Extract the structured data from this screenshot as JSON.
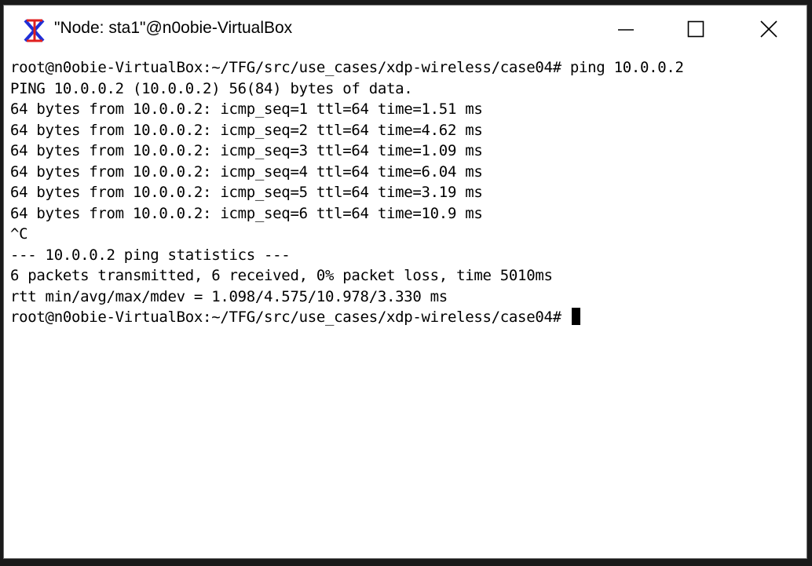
{
  "window": {
    "title": "\"Node: sta1\"@n0obie-VirtualBox",
    "icon": "x-window-icon",
    "controls": [
      "minimize",
      "maximize",
      "close"
    ]
  },
  "terminal": {
    "lines": [
      "root@n0obie-VirtualBox:~/TFG/src/use_cases/xdp-wireless/case04# ping 10.0.0.2",
      "PING 10.0.0.2 (10.0.0.2) 56(84) bytes of data.",
      "64 bytes from 10.0.0.2: icmp_seq=1 ttl=64 time=1.51 ms",
      "64 bytes from 10.0.0.2: icmp_seq=2 ttl=64 time=4.62 ms",
      "64 bytes from 10.0.0.2: icmp_seq=3 ttl=64 time=1.09 ms",
      "64 bytes from 10.0.0.2: icmp_seq=4 ttl=64 time=6.04 ms",
      "64 bytes from 10.0.0.2: icmp_seq=5 ttl=64 time=3.19 ms",
      "64 bytes from 10.0.0.2: icmp_seq=6 ttl=64 time=10.9 ms",
      "^C",
      "--- 10.0.0.2 ping statistics ---",
      "6 packets transmitted, 6 received, 0% packet loss, time 5010ms",
      "rtt min/avg/max/mdev = 1.098/4.575/10.978/3.330 ms"
    ],
    "prompt": "root@n0obie-VirtualBox:~/TFG/src/use_cases/xdp-wireless/case04# "
  }
}
